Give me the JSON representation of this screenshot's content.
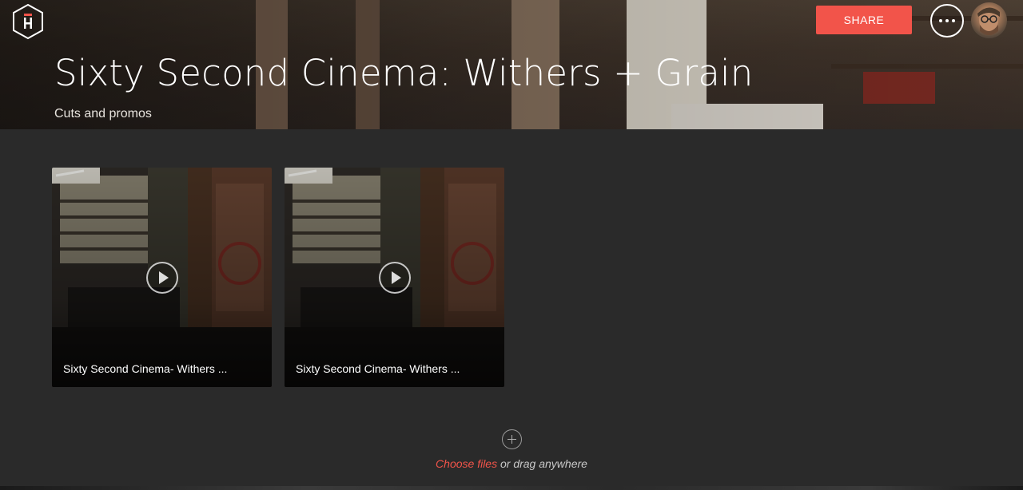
{
  "header": {
    "logo_icon": "hexagon-h-logo-icon",
    "share_label": "SHARE",
    "more_icon": "more-dots-icon",
    "avatar_icon": "user-avatar"
  },
  "project": {
    "title": "Sixty Second Cinema: Withers + Grain",
    "subtitle": "Cuts and promos"
  },
  "media": [
    {
      "title": "Sixty Second Cinema- Withers ...",
      "icon": "play-icon"
    },
    {
      "title": "Sixty Second Cinema- Withers ...",
      "icon": "play-icon"
    }
  ],
  "upload": {
    "icon": "add-circle-icon",
    "choose_label": "Choose files",
    "rest_label": " or drag anywhere"
  },
  "colors": {
    "accent": "#f2544a",
    "background": "#2a2a2a"
  }
}
